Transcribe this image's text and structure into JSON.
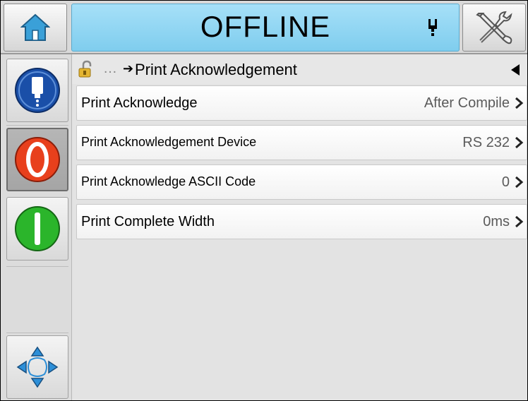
{
  "header": {
    "status": "OFFLINE",
    "home_icon": "home-icon",
    "tools_icon": "tools-icon",
    "indicator_icon": "printhead-icon"
  },
  "sidebar": {
    "buttons": [
      {
        "name": "ink-icon",
        "color": "#1a4fa8"
      },
      {
        "name": "stop-icon",
        "color": "#e8401c"
      },
      {
        "name": "start-icon",
        "color": "#2bb52b"
      },
      {
        "name": "navigation-icon",
        "color": "#2d8fd8"
      }
    ]
  },
  "breadcrumb": {
    "ellipsis": "…",
    "arrow": "➔",
    "title": "Print Acknowledgement"
  },
  "settings": [
    {
      "label": "Print Acknowledge",
      "value": "After Compile"
    },
    {
      "label": "Print Acknowledgement Device",
      "value": "RS 232"
    },
    {
      "label": "Print Acknowledge ASCII Code",
      "value": "0"
    },
    {
      "label": "Print Complete Width",
      "value": "0ms"
    }
  ]
}
